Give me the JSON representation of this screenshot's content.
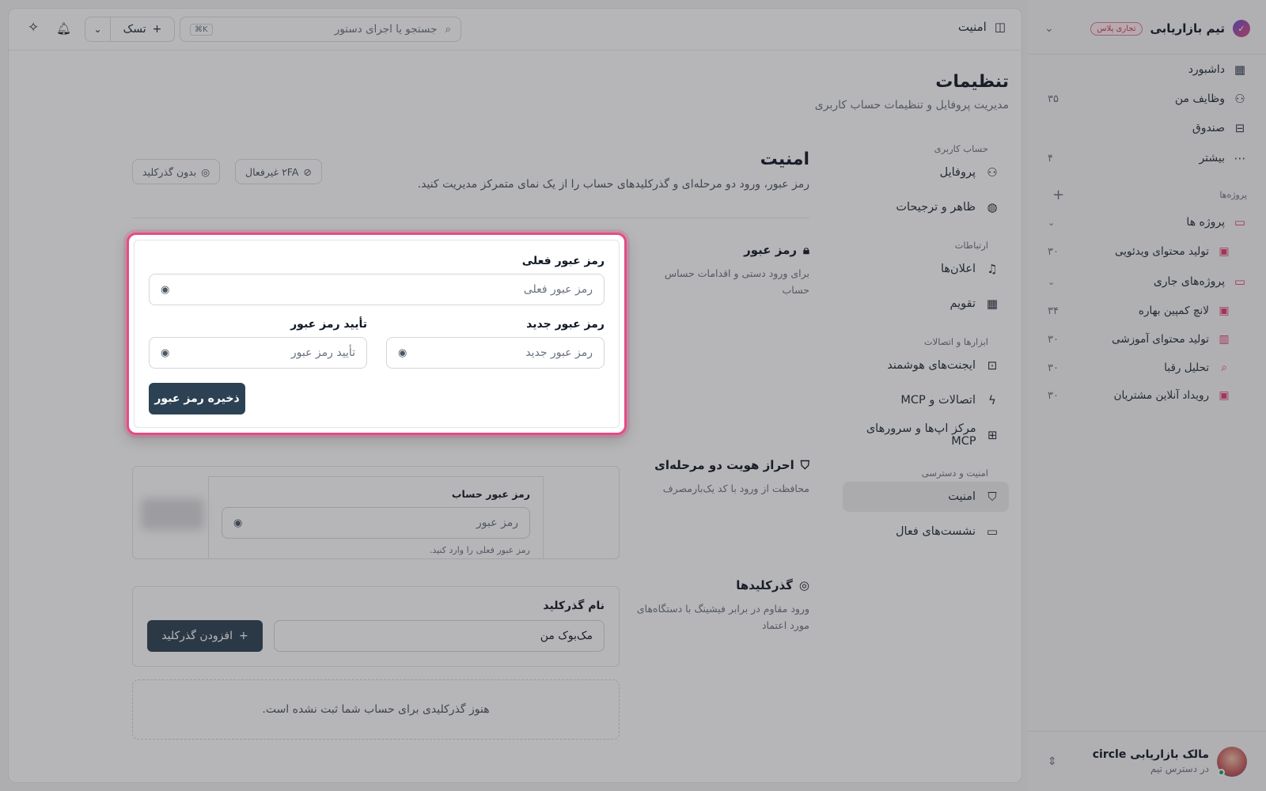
{
  "sidebar": {
    "team_name": "تیم بازاریابی",
    "plan_badge": "تجاری پلاس",
    "nav": [
      {
        "label": "داشبورد",
        "icon": "grid-icon",
        "count": ""
      },
      {
        "label": "وظایف من",
        "icon": "user-icon",
        "count": "۳۵"
      },
      {
        "label": "صندوق",
        "icon": "inbox-icon",
        "count": ""
      },
      {
        "label": "بیشتر",
        "icon": "more-icon",
        "count": "۴"
      }
    ],
    "projects_label": "پروژه‌ها",
    "groups": [
      {
        "label": "پروژه ها",
        "items": [
          {
            "label": "تولید محتوای ویدئویی",
            "count": "۳۰",
            "icon": "briefcase-icon"
          }
        ]
      },
      {
        "label": "پروژه‌های جاری",
        "items": [
          {
            "label": "لانچ کمپین بهاره",
            "count": "۳۴",
            "icon": "briefcase-icon"
          },
          {
            "label": "تولید محتوای آموزشی",
            "count": "۳۰",
            "icon": "book-icon"
          },
          {
            "label": "تحلیل رقبا",
            "count": "۳۰",
            "icon": "search-icon"
          },
          {
            "label": "رویداد آنلاین مشتریان",
            "count": "۳۰",
            "icon": "briefcase-icon"
          }
        ]
      }
    ],
    "user": {
      "name": "مالک بازاریابی circle",
      "sub": "در دسترس تیم"
    }
  },
  "topbar": {
    "title": "امنیت",
    "search_placeholder": "جستجو یا اجرای دستور",
    "search_kbd": "⌘K",
    "task_label": "تسک"
  },
  "page": {
    "title": "تنظیمات",
    "subtitle": "مدیریت پروفایل و تنظیمات حساب کاربری"
  },
  "settings_nav": {
    "groups": [
      {
        "label": "حساب کاربری",
        "items": [
          {
            "label": "پروفایل",
            "icon": "user-icon"
          },
          {
            "label": "ظاهر و ترجیحات",
            "icon": "palette-icon"
          }
        ]
      },
      {
        "label": "ارتباطات",
        "items": [
          {
            "label": "اعلان‌ها",
            "icon": "bell-icon"
          },
          {
            "label": "تقویم",
            "icon": "calendar-icon"
          }
        ]
      },
      {
        "label": "ابزارها و اتصالات",
        "items": [
          {
            "label": "ایجنت‌های هوشمند",
            "icon": "bot-icon"
          },
          {
            "label": "اتصالات و MCP",
            "icon": "plug-icon"
          },
          {
            "label": "مرکز اپ‌ها و سرورهای MCP",
            "icon": "apps-icon"
          }
        ]
      },
      {
        "label": "امنیت و دسترسی",
        "items": [
          {
            "label": "امنیت",
            "icon": "shield-icon",
            "active": true
          },
          {
            "label": "نشست‌های فعال",
            "icon": "monitor-icon"
          }
        ]
      }
    ]
  },
  "security": {
    "title": "امنیت",
    "subtitle": "رمز عبور، ورود دو مرحله‌ای و گذرکلیدهای حساب را از یک نمای متمرکز مدیریت کنید.",
    "chip_2fa": "۲FA غیرفعال",
    "chip_passkey": "بدون گذرکلید",
    "password": {
      "title": "رمز عبور",
      "desc": "برای ورود دستی و اقدامات حساس حساب",
      "current_label": "رمز عبور فعلی",
      "current_placeholder": "رمز عبور فعلی",
      "new_label": "رمز عبور جدید",
      "new_placeholder": "رمز عبور جدید",
      "confirm_label": "تأیید رمز عبور",
      "confirm_placeholder": "تأیید رمز عبور",
      "save_label": "ذخیره رمز عبور"
    },
    "twofa": {
      "title": "احراز هویت دو مرحله‌ای",
      "desc": "محافظت از ورود با کد یک‌بارمصرف",
      "field_label": "رمز عبور حساب",
      "placeholder": "رمز عبور",
      "hint": "رمز عبور فعلی را وارد کنید."
    },
    "passkeys": {
      "title": "گذرکلیدها",
      "desc": "ورود مقاوم در برابر فیشینگ با دستگاه‌های مورد اعتماد",
      "name_label": "نام گذرکلید",
      "name_value": "مک‌بوک من",
      "add_label": "افزودن گذرکلید",
      "empty": "هنوز گذرکلیدی برای حساب شما ثبت نشده است."
    }
  }
}
